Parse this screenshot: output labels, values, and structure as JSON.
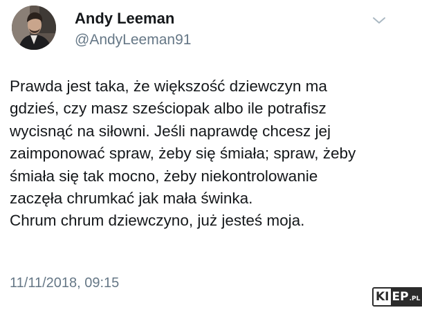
{
  "author": {
    "display_name": "Andy Leeman",
    "handle": "@AndyLeeman91"
  },
  "tweet": {
    "text": "Prawda jest taka, że większość dziewczyn ma\ngdzieś, czy masz sześciopak albo ile potrafisz\nwycisnąć na siłowni. Jeśli naprawdę chcesz jej\nzaimponować spraw, żeby się śmiała; spraw, żeby\nśmiała się tak mocno, żeby niekontrolowanie\nzaczęła chrumkać jak mała świnka.\nChrum chrum dziewczyno, już jesteś moja.",
    "timestamp": "11/11/2018, 09:15"
  },
  "watermark": {
    "part_a": "KI",
    "part_b": "EP",
    "part_c": ".PL"
  },
  "icons": {
    "menu": "chevron-down-icon",
    "avatar": "avatar"
  },
  "colors": {
    "text": "#14171a",
    "secondary": "#657786",
    "caret": "#aab8c2"
  }
}
